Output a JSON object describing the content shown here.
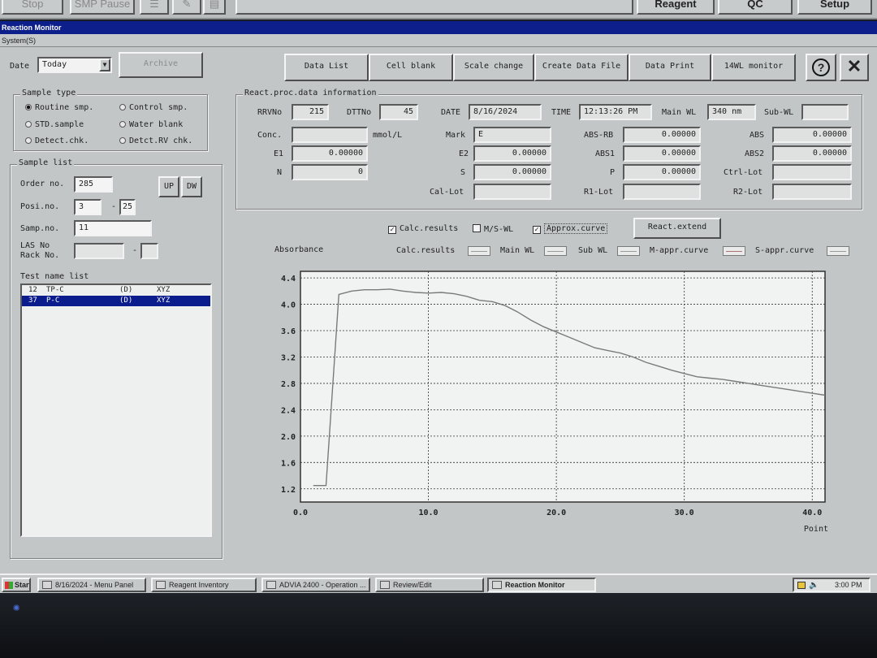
{
  "top_toolbar": {
    "stop": "Stop",
    "smp_pause": "SMP Pause",
    "reagent": "Reagent",
    "qc": "QC",
    "setup": "Setup"
  },
  "window": {
    "title": "Reaction Monitor",
    "menu_system": "System(S)"
  },
  "top_controls": {
    "date_label": "Date",
    "date_value": "Today",
    "archive": "Archive",
    "buttons": [
      "Data List",
      "Cell blank",
      "Scale change",
      "Create Data File",
      "Data Print",
      "14WL monitor"
    ],
    "help_icon": "question-icon",
    "close_icon": "close-icon"
  },
  "sample_type": {
    "title": "Sample type",
    "options": [
      {
        "label": "Routine smp.",
        "selected": true
      },
      {
        "label": "Control smp.",
        "selected": false
      },
      {
        "label": "STD.sample",
        "selected": false
      },
      {
        "label": "Water blank",
        "selected": false
      },
      {
        "label": "Detect.chk.",
        "selected": false
      },
      {
        "label": "Detct.RV chk.",
        "selected": false
      }
    ]
  },
  "sample_list": {
    "title": "Sample list",
    "order_no_label": "Order no.",
    "order_no": "285",
    "up": "UP",
    "dw": "DW",
    "posi_no_label": "Posi.no.",
    "posi_from": "3",
    "posi_sep": "-",
    "posi_to": "25",
    "samp_no_label": "Samp.no.",
    "samp_no": "11",
    "las_label_1": "LAS No",
    "las_label_2": "Rack No.",
    "las_value": "",
    "las_sep": "-",
    "las_value2": "",
    "test_list_title": "Test name list",
    "tests": [
      {
        "no": "12",
        "name": "TP-C",
        "flag": "(D)",
        "code": "XYZ",
        "selected": false
      },
      {
        "no": "37",
        "name": "P-C",
        "flag": "(D)",
        "code": "XYZ",
        "selected": true
      }
    ]
  },
  "react_info": {
    "title": "React.proc.data information",
    "rrv_label": "RRVNo",
    "rrv": "215",
    "dtt_label": "DTTNo",
    "dtt": "45",
    "date_label": "DATE",
    "date": "8/16/2024",
    "time_label": "TIME",
    "time": "12:13:26 PM",
    "mainwl_label": "Main WL",
    "mainwl": "340 nm",
    "subwl_label": "Sub-WL",
    "subwl": "",
    "conc_label": "Conc.",
    "conc": "",
    "conc_unit": "mmol/L",
    "mark_label": "Mark",
    "mark": "E",
    "absrb_label": "ABS-RB",
    "absrb": "0.00000",
    "abs_label": "ABS",
    "abs": "0.00000",
    "e1_label": "E1",
    "e1": "0.00000",
    "e2_label": "E2",
    "e2": "0.00000",
    "abs1_label": "ABS1",
    "abs1": "0.00000",
    "abs2_label": "ABS2",
    "abs2": "0.00000",
    "n_label": "N",
    "n": "0",
    "s_label": "S",
    "s": "0.00000",
    "p_label": "P",
    "p": "0.00000",
    "ctrllot_label": "Ctrl-Lot",
    "ctrllot": "",
    "callot_label": "Cal-Lot",
    "callot": "",
    "r1lot_label": "R1-Lot",
    "r1lot": "",
    "r2lot_label": "R2-Lot",
    "r2lot": ""
  },
  "chart_options": {
    "calc_results": {
      "label": "Calc.results",
      "checked": true
    },
    "msw": {
      "label": "M/S-WL",
      "checked": false
    },
    "approx": {
      "label": "Approx.curve",
      "checked": true
    },
    "react_extend": "React.extend"
  },
  "legend": {
    "absorbance": "Absorbance",
    "calc_results": "Calc.results",
    "main_wl": "Main WL",
    "sub_wl": "Sub WL",
    "m_appr": "M-appr.curve",
    "s_appr": "S-appr.curve"
  },
  "chart_data": {
    "type": "line",
    "xlabel": "Point",
    "ylabel": "Absorbance",
    "xlim": [
      0,
      41
    ],
    "ylim": [
      1.0,
      4.5
    ],
    "xticks": [
      "0.0",
      "10.0",
      "20.0",
      "30.0",
      "40.0"
    ],
    "xtick_values": [
      0,
      10,
      20,
      30,
      40
    ],
    "yticks": [
      "1.2",
      "1.6",
      "2.0",
      "2.4",
      "2.8",
      "3.2",
      "3.6",
      "4.0",
      "4.4"
    ],
    "ytick_values": [
      1.2,
      1.6,
      2.0,
      2.4,
      2.8,
      3.2,
      3.6,
      4.0,
      4.4
    ],
    "grid": true,
    "series": [
      {
        "color": "#7a7a7a",
        "x": [
          1,
          2,
          3,
          4,
          5,
          6,
          7,
          8,
          9,
          10,
          11,
          12,
          13,
          14,
          15,
          16,
          17,
          18,
          19,
          20,
          21,
          22,
          23,
          24,
          25,
          26,
          27,
          28,
          29,
          30,
          31,
          32,
          33,
          34,
          35,
          36,
          37,
          38,
          39,
          40,
          41
        ],
        "y": [
          1.25,
          1.25,
          4.15,
          4.2,
          4.22,
          4.22,
          4.23,
          4.2,
          4.18,
          4.17,
          4.18,
          4.16,
          4.12,
          4.06,
          4.04,
          3.98,
          3.88,
          3.76,
          3.66,
          3.58,
          3.5,
          3.42,
          3.34,
          3.3,
          3.26,
          3.2,
          3.12,
          3.06,
          3.0,
          2.95,
          2.9,
          2.88,
          2.86,
          2.83,
          2.8,
          2.77,
          2.74,
          2.71,
          2.68,
          2.65,
          2.62
        ]
      }
    ]
  },
  "taskbar": {
    "start": "Start",
    "items": [
      "8/16/2024 - Menu Panel",
      "Reagent Inventory",
      "ADVIA 2400 - Operation ...",
      "Review/Edit",
      "Reaction Monitor"
    ],
    "clock": "3:00 PM"
  }
}
